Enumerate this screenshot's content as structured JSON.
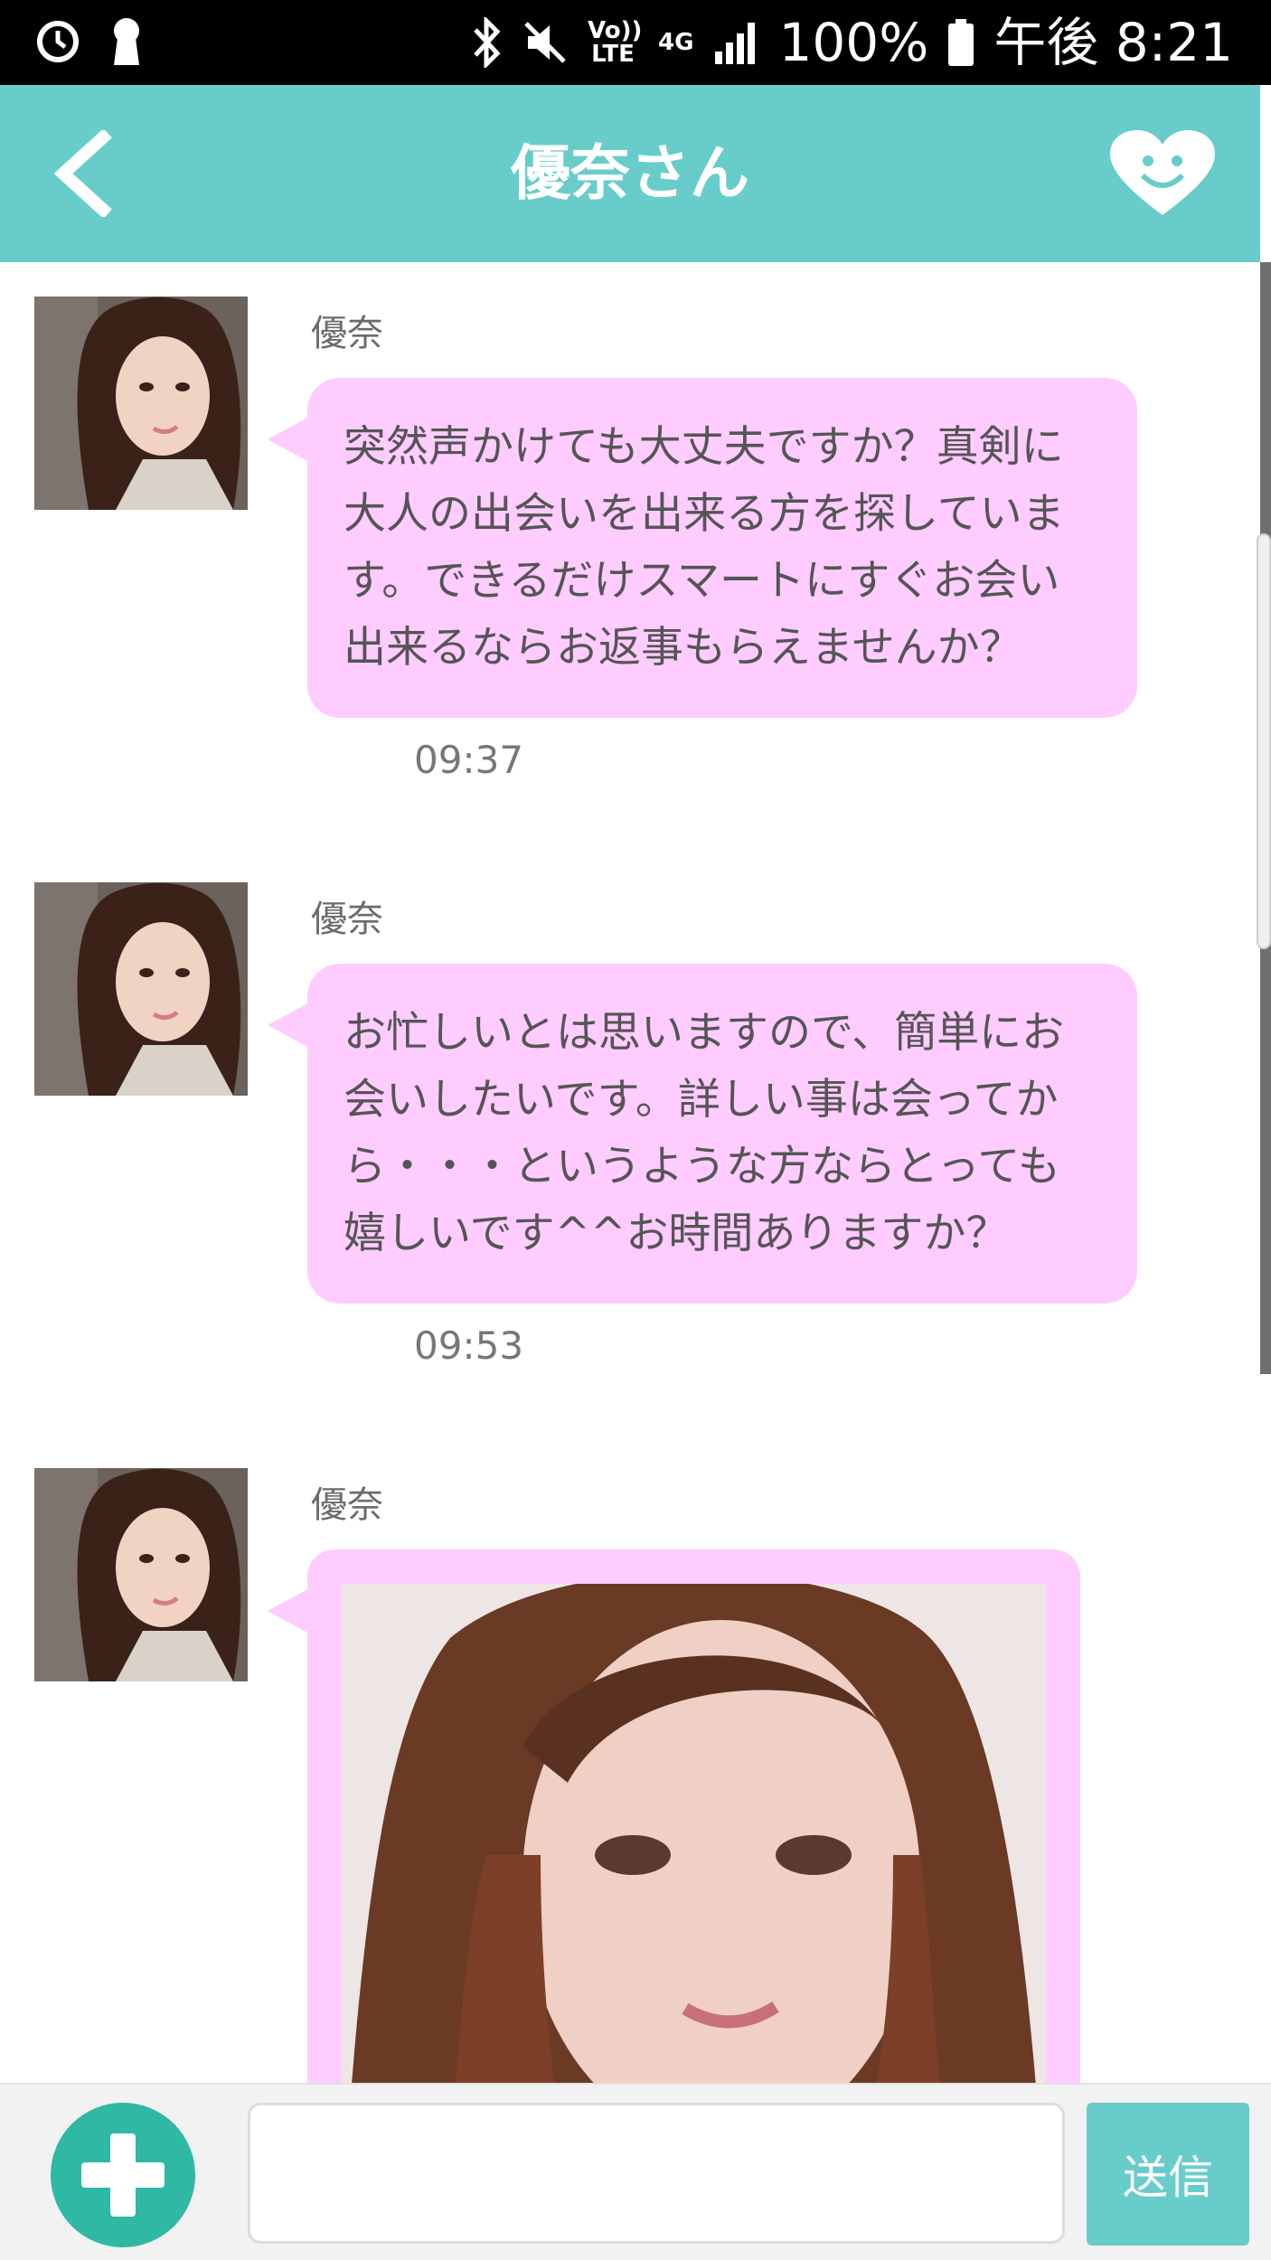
{
  "status_bar": {
    "lte_label": "Vo)) LTE",
    "net_label": "4G",
    "battery": "100%",
    "time": "午後 8:21"
  },
  "header": {
    "title": "優奈さん",
    "accent_color": "#68cdca"
  },
  "messages": [
    {
      "sender": "優奈",
      "text": "突然声かけても大丈夫ですか？真剣に大人の出会いを出来る方を探しています。できるだけスマートにすぐお会い出来るならお返事もらえませんか？",
      "time": "09:37"
    },
    {
      "sender": "優奈",
      "text": "お忙しいとは思いますので、簡単にお会いしたいです。詳しい事は会ってから・・・というような方ならとっても嬉しいです^^お時間ありますか？",
      "time": "09:53"
    },
    {
      "sender": "優奈",
      "type": "image"
    }
  ],
  "composer": {
    "input_value": "",
    "send_label": "送信"
  },
  "colors": {
    "bubble": "#ffccff",
    "add_button": "#2fb8a3"
  }
}
